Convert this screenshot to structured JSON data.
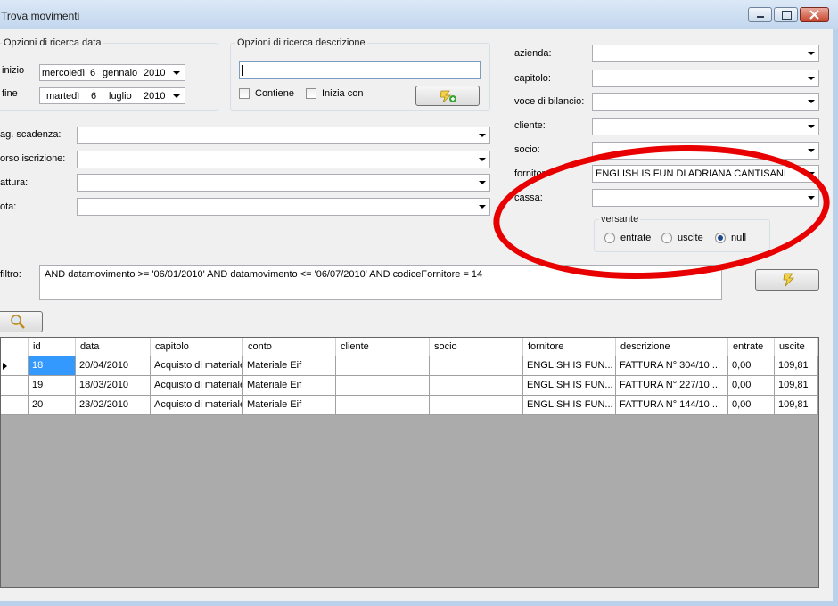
{
  "window": {
    "title": "Trova movimenti"
  },
  "date_group": {
    "title": "Opzioni di ricerca data",
    "inizio_label": "inizio",
    "fine_label": "fine",
    "inizio": {
      "weekday": "mercoledì",
      "day": "6",
      "month": "gennaio",
      "year": "2010"
    },
    "fine": {
      "weekday": "martedì",
      "day": "6",
      "month": "luglio",
      "year": "2010"
    }
  },
  "desc_group": {
    "title": "Opzioni di ricerca descrizione",
    "text_value": "",
    "contiene_label": "Contiene",
    "inizia_label": "Inizia con"
  },
  "left_filters": {
    "pag_scadenza_label": "ag. scadenza:",
    "corso_label": "orso iscrizione:",
    "fattura_label": "attura:",
    "nota_label": "ota:"
  },
  "right_filters": {
    "azienda_label": "azienda:",
    "capitolo_label": "capitolo:",
    "voce_label": "voce di bilancio:",
    "cliente_label": "cliente:",
    "socio_label": "socio:",
    "fornitore_label": "fornitore:",
    "fornitore_value": "ENGLISH IS FUN DI ADRIANA CANTISANI",
    "cassa_label": "cassa:"
  },
  "versante": {
    "title": "versante",
    "entrate": "entrate",
    "uscite": "uscite",
    "null": "null",
    "selected": "null"
  },
  "filtro": {
    "label": "filtro:",
    "value": "AND datamovimento >= '06/01/2010' AND datamovimento <= '06/07/2010' AND codiceFornitore = 14"
  },
  "grid": {
    "columns": [
      "id",
      "data",
      "capitolo",
      "conto",
      "cliente",
      "socio",
      "fornitore",
      "descrizione",
      "entrate",
      "uscite"
    ],
    "rows": [
      [
        "18",
        "20/04/2010",
        "Acquisto di materiale",
        "Materiale Eif",
        "",
        "",
        "ENGLISH IS FUN...",
        "FATTURA N° 304/10 ...",
        "0,00",
        "109,81"
      ],
      [
        "19",
        "18/03/2010",
        "Acquisto di materiale",
        "Materiale Eif",
        "",
        "",
        "ENGLISH IS FUN...",
        "FATTURA N° 227/10 ...",
        "0,00",
        "109,81"
      ],
      [
        "20",
        "23/02/2010",
        "Acquisto di materiale",
        "Materiale Eif",
        "",
        "",
        "ENGLISH IS FUN...",
        "FATTURA N° 144/10 ...",
        "0,00",
        "109,81"
      ]
    ]
  },
  "colors": {
    "annotation": "#e80000",
    "selection": "#3399ff"
  }
}
